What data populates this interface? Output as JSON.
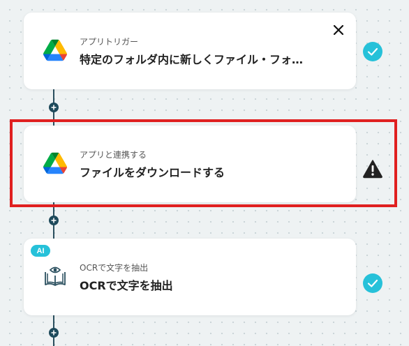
{
  "steps": [
    {
      "label": "アプリトリガー",
      "title": "特定のフォルダ内に新しくファイル・フォ…",
      "icon": "google-drive-icon",
      "status": "check"
    },
    {
      "label": "アプリと連携する",
      "title": "ファイルをダウンロードする",
      "icon": "google-drive-icon",
      "status": "warning"
    },
    {
      "label": "OCRで文字を抽出",
      "title": "OCRで文字を抽出",
      "icon": "ocr-book-eye-icon",
      "status": "check",
      "badge": "AI"
    }
  ],
  "colors": {
    "accent": "#26c1d9",
    "highlight": "#e02020",
    "connector": "#1e4a5b"
  }
}
